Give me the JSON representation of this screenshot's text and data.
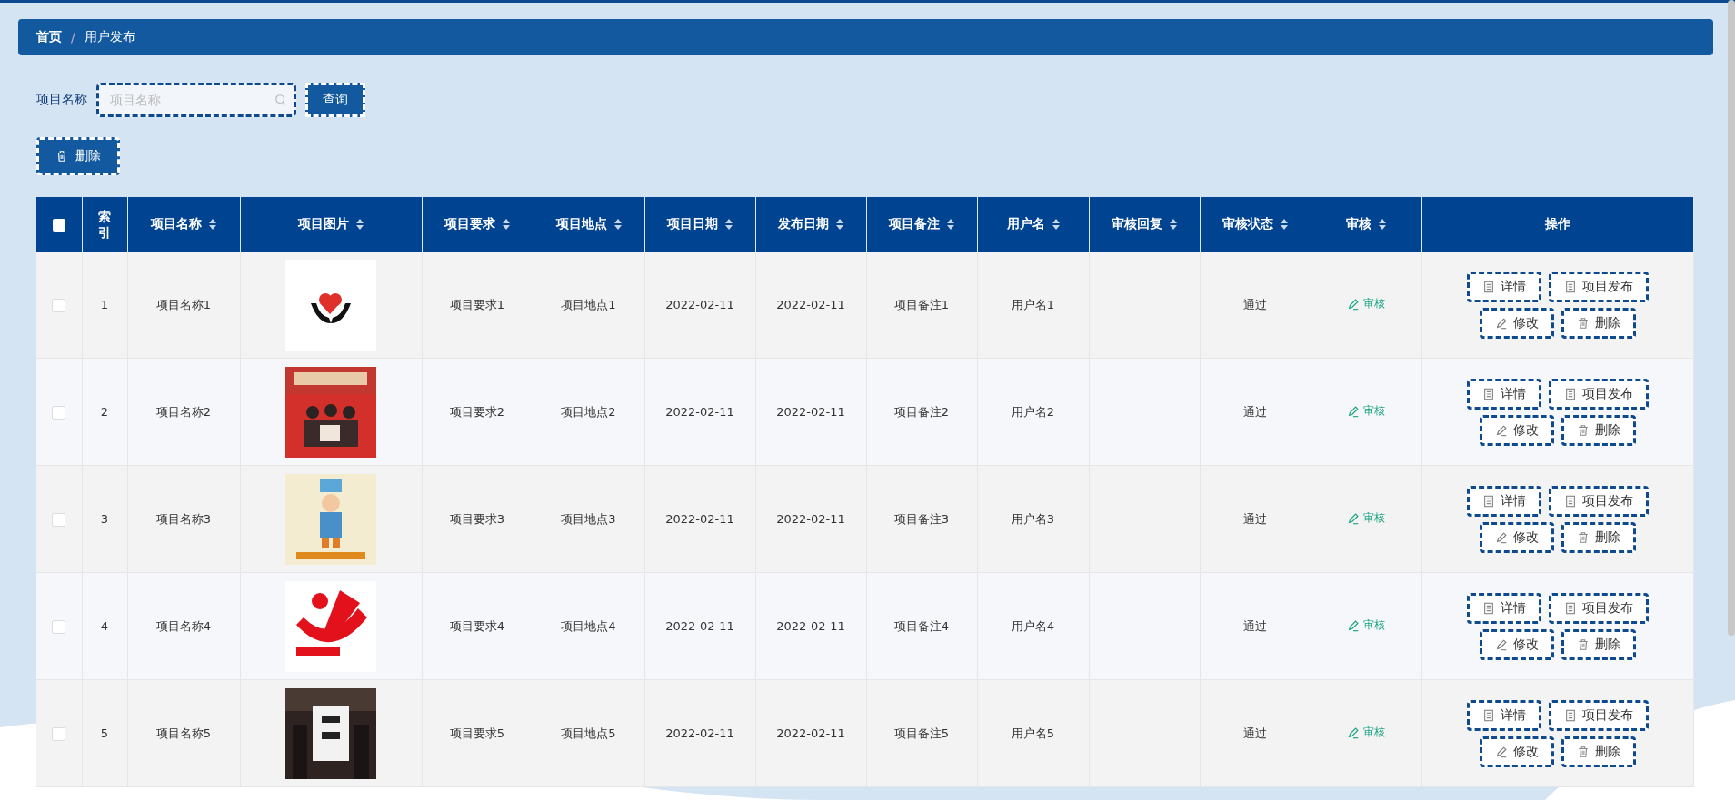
{
  "breadcrumb": [
    {
      "label": "首页",
      "current": false
    },
    {
      "label": "/",
      "kind": "separator"
    },
    {
      "label": "用户发布",
      "current": true
    }
  ],
  "search": {
    "label": "项目名称",
    "placeholder": "项目名称",
    "button": "查询"
  },
  "toolbar": {
    "delete_button": "删除"
  },
  "table": {
    "select_all": {
      "checked": false
    },
    "columns": [
      {
        "label": "索引",
        "sortable": false
      },
      {
        "label": "项目名称",
        "sortable": true
      },
      {
        "label": "项目图片",
        "sortable": true
      },
      {
        "label": "项目要求",
        "sortable": true
      },
      {
        "label": "项目地点",
        "sortable": true
      },
      {
        "label": "项目日期",
        "sortable": true
      },
      {
        "label": "发布日期",
        "sortable": true
      },
      {
        "label": "项目备注",
        "sortable": true
      },
      {
        "label": "用户名",
        "sortable": true
      },
      {
        "label": "审核回复",
        "sortable": true
      },
      {
        "label": "审核状态",
        "sortable": true
      },
      {
        "label": "审核",
        "sortable": true
      },
      {
        "label": "操作",
        "sortable": false
      }
    ],
    "rows": [
      {
        "checked": false,
        "index": "1",
        "name": "项目名称1",
        "image": {
          "kind": "picture"
        },
        "requirement": "项目要求1",
        "location": "项目地点1",
        "project_date": "2022-02-11",
        "publish_date": "2022-02-11",
        "note": "项目备注1",
        "username": "用户名1",
        "review_status": "通过",
        "review_link": "审核",
        "actions": [
          {
            "kind": "detail",
            "label": "详情"
          },
          {
            "kind": "publish",
            "label": "项目发布"
          },
          {
            "kind": "edit",
            "label": "修改"
          },
          {
            "kind": "delete",
            "label": "删除"
          }
        ]
      },
      {
        "checked": false,
        "index": "2",
        "name": "项目名称2",
        "image": {
          "kind": "picture"
        },
        "requirement": "项目要求2",
        "location": "项目地点2",
        "project_date": "2022-02-11",
        "publish_date": "2022-02-11",
        "note": "项目备注2",
        "username": "用户名2",
        "review_status": "通过",
        "review_link": "审核",
        "actions": [
          {
            "kind": "detail",
            "label": "详情"
          },
          {
            "kind": "publish",
            "label": "项目发布"
          },
          {
            "kind": "edit",
            "label": "修改"
          },
          {
            "kind": "delete",
            "label": "删除"
          }
        ]
      },
      {
        "checked": false,
        "index": "3",
        "name": "项目名称3",
        "image": {
          "kind": "picture"
        },
        "requirement": "项目要求3",
        "location": "项目地点3",
        "project_date": "2022-02-11",
        "publish_date": "2022-02-11",
        "note": "项目备注3",
        "username": "用户名3",
        "review_status": "通过",
        "review_link": "审核",
        "actions": [
          {
            "kind": "detail",
            "label": "详情"
          },
          {
            "kind": "publish",
            "label": "项目发布"
          },
          {
            "kind": "edit",
            "label": "修改"
          },
          {
            "kind": "delete",
            "label": "删除"
          }
        ]
      },
      {
        "checked": false,
        "index": "4",
        "name": "项目名称4",
        "image": {
          "kind": "picture"
        },
        "requirement": "项目要求4",
        "location": "项目地点4",
        "project_date": "2022-02-11",
        "publish_date": "2022-02-11",
        "note": "项目备注4",
        "username": "用户名4",
        "review_status": "通过",
        "review_link": "审核",
        "actions": [
          {
            "kind": "detail",
            "label": "详情"
          },
          {
            "kind": "publish",
            "label": "项目发布"
          },
          {
            "kind": "edit",
            "label": "修改"
          },
          {
            "kind": "delete",
            "label": "删除"
          }
        ]
      },
      {
        "checked": false,
        "index": "5",
        "name": "项目名称5",
        "image": {
          "kind": "picture"
        },
        "requirement": "项目要求5",
        "location": "项目地点5",
        "project_date": "2022-02-11",
        "publish_date": "2022-02-11",
        "note": "项目备注5",
        "username": "用户名5",
        "review_status": "通过",
        "review_link": "审核",
        "actions": [
          {
            "kind": "detail",
            "label": "详情"
          },
          {
            "kind": "publish",
            "label": "项目发布"
          },
          {
            "kind": "edit",
            "label": "修改"
          },
          {
            "kind": "delete",
            "label": "删除"
          }
        ]
      }
    ]
  }
}
